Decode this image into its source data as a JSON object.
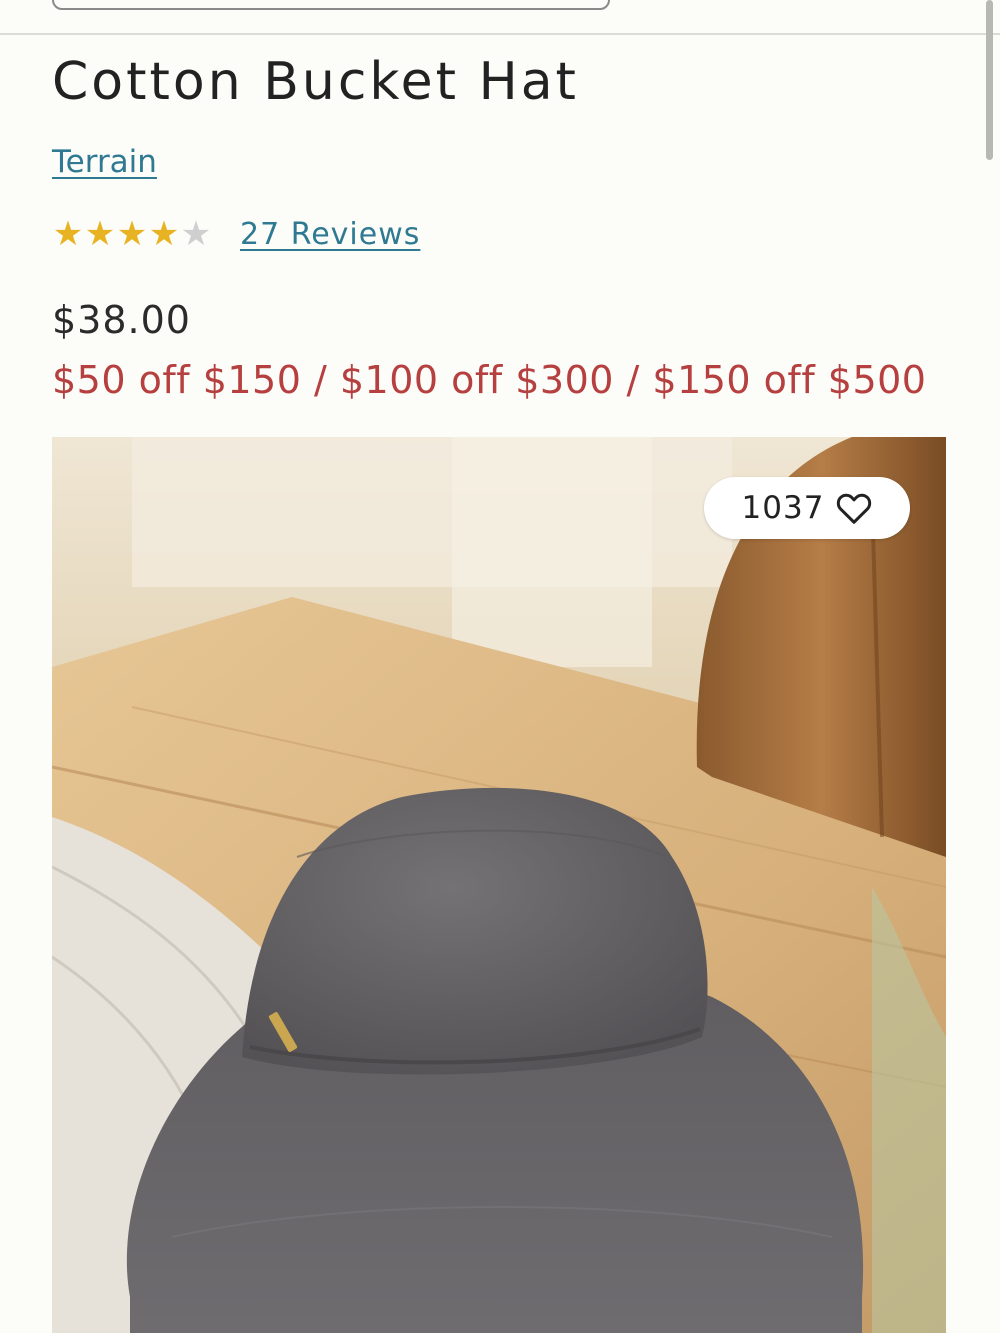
{
  "product": {
    "title": "Cotton Bucket Hat",
    "brand": "Terrain",
    "rating": 4,
    "rating_max": 5,
    "reviews_label": "27 Reviews",
    "price": "$38.00",
    "promo": "$50 off $150 / $100 off $300 / $150 off $500"
  },
  "image": {
    "likes": "1037",
    "like_icon": "heart-outline-icon",
    "alt": "Cotton Bucket Hat"
  },
  "colors": {
    "link": "#2f7a92",
    "promo": "#b63f3f",
    "star_filled": "#e8b323",
    "star_empty": "#cfcfcf"
  }
}
